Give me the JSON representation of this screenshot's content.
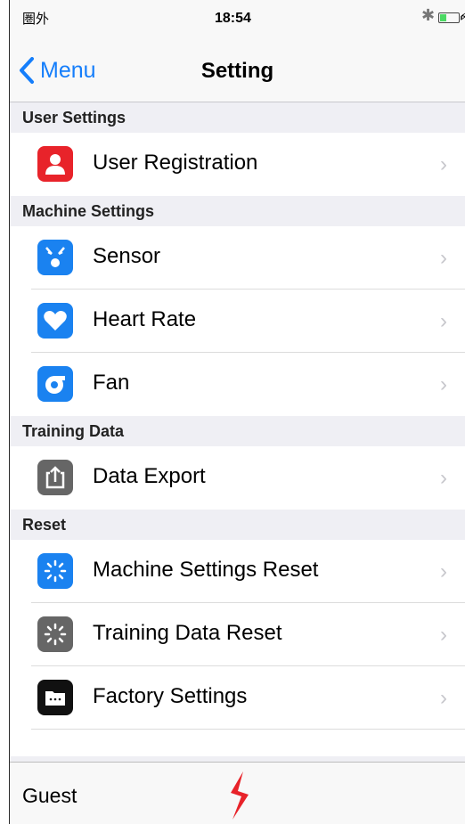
{
  "status_bar": {
    "carrier": "圏外",
    "time": "18:54",
    "bluetooth_icon": "bluetooth-icon",
    "battery_icon": "battery-charging-icon"
  },
  "nav": {
    "back_label": "Menu",
    "title": "Setting"
  },
  "sections": [
    {
      "header": "User Settings",
      "rows": [
        {
          "label": "User Registration",
          "icon": "user-icon",
          "color": "#e8232a"
        }
      ]
    },
    {
      "header": "Machine Settings",
      "rows": [
        {
          "label": "Sensor",
          "icon": "sensor-icon",
          "color": "#1a82f0"
        },
        {
          "label": "Heart Rate",
          "icon": "heart-icon",
          "color": "#1a82f0"
        },
        {
          "label": "Fan",
          "icon": "fan-icon",
          "color": "#1a82f0"
        }
      ]
    },
    {
      "header": "Training Data",
      "rows": [
        {
          "label": "Data Export",
          "icon": "export-icon",
          "color": "#666666"
        }
      ]
    },
    {
      "header": "Reset",
      "rows": [
        {
          "label": "Machine Settings Reset",
          "icon": "reset-spinner-icon",
          "color": "#1a82f0"
        },
        {
          "label": "Training Data Reset",
          "icon": "reset-spinner-icon",
          "color": "#666666"
        },
        {
          "label": "Factory Settings",
          "icon": "folder-icon",
          "color": "#111111"
        }
      ]
    }
  ],
  "tab_bar": {
    "user_label": "Guest",
    "logo_icon": "brand-logo-icon"
  },
  "colors": {
    "accent": "#157efb",
    "background": "#efeff4"
  }
}
